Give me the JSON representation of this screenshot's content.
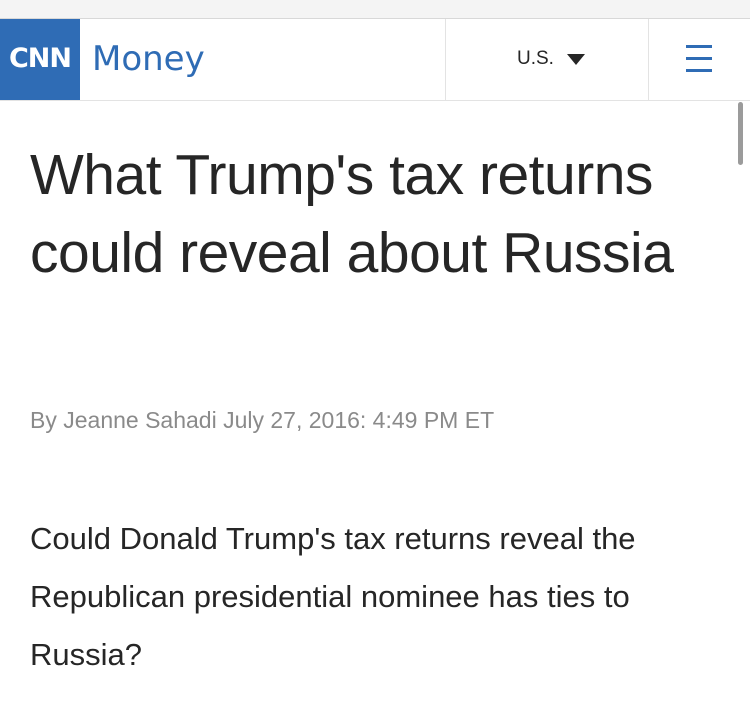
{
  "header": {
    "logo_text": "CNN",
    "brand_name": "Money",
    "edition_label": "U.S.",
    "edition_icon": "caret-down-icon",
    "menu_icon": "hamburger-menu-icon",
    "brand_color": "#2f6cb5"
  },
  "article": {
    "headline": "What Trump's tax returns could reveal about Russia",
    "byline": "By Jeanne Sahadi July 27, 2016: 4:49 PM ET",
    "paragraphs": [
      "Could Donald Trump's tax returns reveal the Republican presidential nominee has ties to Russia?"
    ]
  }
}
